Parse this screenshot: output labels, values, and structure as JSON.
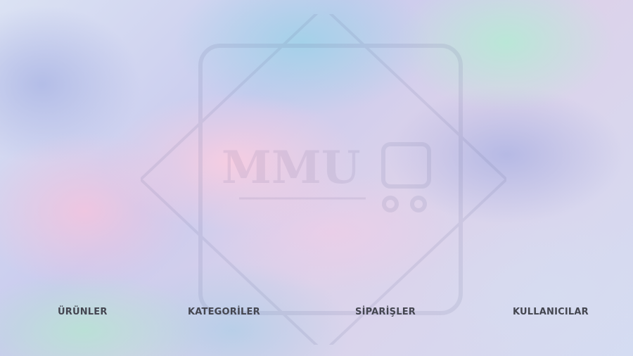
{
  "watermark": {
    "logo_text": "MMU"
  },
  "nav": {
    "items": [
      {
        "id": "urunler",
        "label": "ÜRÜNLER"
      },
      {
        "id": "kategoriler",
        "label": "KATEGORİLER"
      },
      {
        "id": "siparisler",
        "label": "SİPARİŞLER"
      },
      {
        "id": "kullanicilar",
        "label": "KULLANICILAR"
      }
    ]
  },
  "colors": {
    "nav_text": "#444650",
    "pink_blob": "#f8cde1",
    "blue_blob": "#a0d2e8",
    "mint_blob": "#b8e8d6",
    "lavender_blob": "#b4b8e4"
  }
}
